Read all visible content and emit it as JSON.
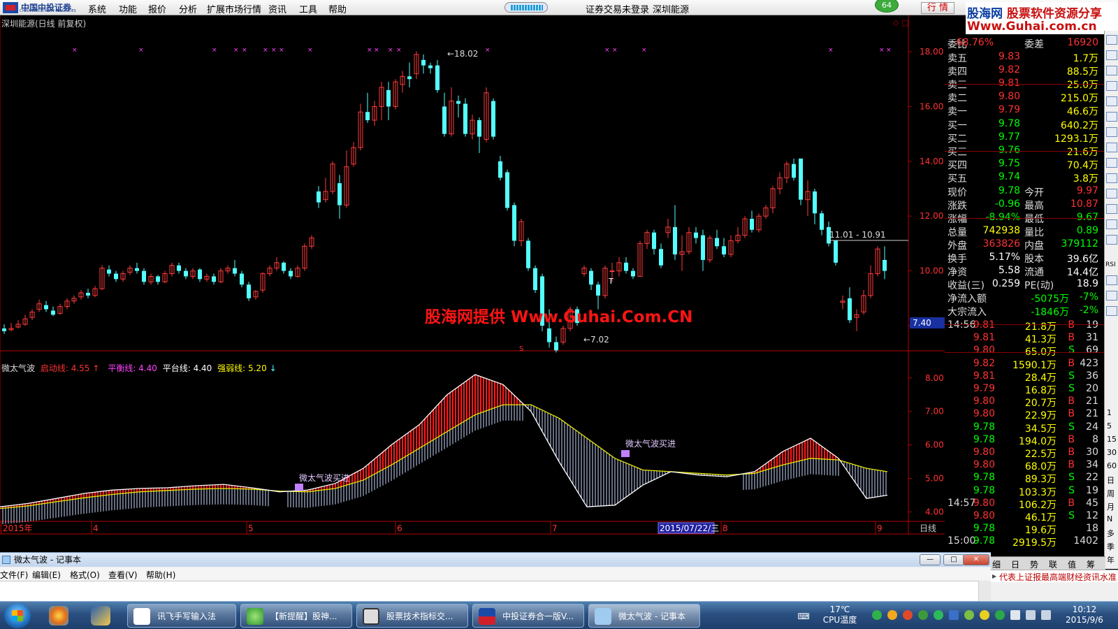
{
  "menubar": {
    "logo_text": "中国中投证券",
    "logo_sub": "CHINA INVESTMENT SECURITIES",
    "items": [
      "系统",
      "功能",
      "报价",
      "分析",
      "扩展市场行情",
      "资讯",
      "工具",
      "帮助"
    ],
    "trade_status": "证券交易未登录",
    "stock_name": "深圳能源",
    "badge": "64",
    "quote_button": "行 情"
  },
  "watermark": {
    "line1_a": "股海网",
    "line1_b": "股票软件资源分享",
    "line2": "Www.Guhai.com.cn",
    "center": "股海网提供 Www.Guhai.Com.CN"
  },
  "chart": {
    "title": "深圳能源(日线 前复权)",
    "high_label": "18.02",
    "low_label": "7.02",
    "range_label": "11.01 - 10.91",
    "price_box": "7.40",
    "y_ticks": [
      "18.00",
      "16.00",
      "14.00",
      "12.00",
      "10.00",
      "8.00"
    ],
    "ind_ticks": [
      "8.00",
      "7.00",
      "6.00",
      "5.00",
      "4.00"
    ],
    "x_labels": [
      "2015年",
      "4",
      "5",
      "6",
      "7",
      "2015/07/22/三",
      "8",
      "9"
    ],
    "period": "日线",
    "signal1": "微太气波买进",
    "signal2": "微太气波买进",
    "marker_T": "T",
    "marker_S": "S",
    "colors": {
      "up": "#ff3c3c",
      "down": "#54ffff",
      "diff": "#ffffff",
      "dea": "#e8e800",
      "axis": "#b00000",
      "tick": "#ff3232"
    }
  },
  "indicator": {
    "name": "微太气波",
    "start_label": "启动线: 4.55",
    "start_arrow": "↑",
    "balance_label": "平衡线: 4.40",
    "platform_label": "平台线: 4.40",
    "strength_label": "强弱线: 5.20",
    "strength_arrow": "↓"
  },
  "quote": {
    "weibi_label": "委比",
    "weibi": "68.76%",
    "weicha_label": "委差",
    "weicha": "16920",
    "asks": [
      {
        "label": "卖五",
        "price": "9.83",
        "vol": "1.7万"
      },
      {
        "label": "卖四",
        "price": "9.82",
        "vol": "88.5万"
      },
      {
        "label": "卖三",
        "price": "9.81",
        "vol": "25.0万"
      },
      {
        "label": "卖二",
        "price": "9.80",
        "vol": "215.0万"
      },
      {
        "label": "卖一",
        "price": "9.79",
        "vol": "46.6万"
      }
    ],
    "bids": [
      {
        "label": "买一",
        "price": "9.78",
        "vol": "640.2万"
      },
      {
        "label": "买二",
        "price": "9.77",
        "vol": "1293.1万"
      },
      {
        "label": "买三",
        "price": "9.76",
        "vol": "21.6万"
      },
      {
        "label": "买四",
        "price": "9.75",
        "vol": "70.4万"
      },
      {
        "label": "买五",
        "price": "9.74",
        "vol": "3.8万"
      }
    ],
    "stats": [
      {
        "l1": "现价",
        "v1": "9.78",
        "c1": "#00ff00",
        "l2": "今开",
        "v2": "9.97",
        "c2": "#ff3232"
      },
      {
        "l1": "涨跌",
        "v1": "-0.96",
        "c1": "#00ff00",
        "l2": "最高",
        "v2": "10.87",
        "c2": "#ff3232"
      },
      {
        "l1": "涨幅",
        "v1": "-8.94%",
        "c1": "#00ff00",
        "l2": "最低",
        "v2": "9.67",
        "c2": "#00ff00"
      },
      {
        "l1": "总量",
        "v1": "742938",
        "c1": "#ffff00",
        "l2": "量比",
        "v2": "0.89",
        "c2": "#00ff00"
      },
      {
        "l1": "外盘",
        "v1": "363826",
        "c1": "#ff3232",
        "l2": "内盘",
        "v2": "379112",
        "c2": "#00ff00"
      },
      {
        "l1": "换手",
        "v1": "5.17%",
        "c1": "#ffffff",
        "l2": "股本",
        "v2": "39.6亿",
        "c2": "#ffffff"
      },
      {
        "l1": "净资",
        "v1": "5.58",
        "c1": "#ffffff",
        "l2": "流通",
        "v2": "14.4亿",
        "c2": "#ffffff"
      },
      {
        "l1": "收益(三)",
        "v1": "0.259",
        "c1": "#ffffff",
        "l2": "PE(动)",
        "v2": "18.9",
        "c2": "#ffffff"
      }
    ],
    "flow": [
      {
        "label": "净流入额",
        "v1": "-5075万",
        "v2": "-7%"
      },
      {
        "label": "大宗流入",
        "v1": "-1846万",
        "v2": "-2%"
      }
    ],
    "ticks": [
      {
        "time": "14:56",
        "price": "9.81",
        "vol": "21.8万",
        "bs": "B",
        "n": "19",
        "pc": "#ff3232",
        "bc": "#ff3232"
      },
      {
        "time": "",
        "price": "9.81",
        "vol": "41.3万",
        "bs": "B",
        "n": "31",
        "pc": "#ff3232",
        "bc": "#ff3232"
      },
      {
        "time": "",
        "price": "9.80",
        "vol": "65.0万",
        "bs": "S",
        "n": "69",
        "pc": "#ff3232",
        "bc": "#00ff00"
      },
      {
        "time": "",
        "price": "9.82",
        "vol": "1590.1万",
        "bs": "B",
        "n": "423",
        "pc": "#ff3232",
        "bc": "#ff3232"
      },
      {
        "time": "",
        "price": "9.81",
        "vol": "28.4万",
        "bs": "S",
        "n": "36",
        "pc": "#ff3232",
        "bc": "#00ff00"
      },
      {
        "time": "",
        "price": "9.79",
        "vol": "16.8万",
        "bs": "S",
        "n": "20",
        "pc": "#ff3232",
        "bc": "#00ff00"
      },
      {
        "time": "",
        "price": "9.80",
        "vol": "20.7万",
        "bs": "B",
        "n": "21",
        "pc": "#ff3232",
        "bc": "#ff3232"
      },
      {
        "time": "",
        "price": "9.80",
        "vol": "22.9万",
        "bs": "B",
        "n": "21",
        "pc": "#ff3232",
        "bc": "#ff3232"
      },
      {
        "time": "",
        "price": "9.78",
        "vol": "34.5万",
        "bs": "S",
        "n": "24",
        "pc": "#00ff00",
        "bc": "#00ff00"
      },
      {
        "time": "",
        "price": "9.78",
        "vol": "194.0万",
        "bs": "B",
        "n": "8",
        "pc": "#00ff00",
        "bc": "#ff3232"
      },
      {
        "time": "",
        "price": "9.80",
        "vol": "22.5万",
        "bs": "B",
        "n": "30",
        "pc": "#ff3232",
        "bc": "#ff3232"
      },
      {
        "time": "",
        "price": "9.80",
        "vol": "68.0万",
        "bs": "B",
        "n": "34",
        "pc": "#ff3232",
        "bc": "#ff3232"
      },
      {
        "time": "",
        "price": "9.78",
        "vol": "89.3万",
        "bs": "S",
        "n": "22",
        "pc": "#00ff00",
        "bc": "#00ff00"
      },
      {
        "time": "",
        "price": "9.78",
        "vol": "103.3万",
        "bs": "S",
        "n": "19",
        "pc": "#00ff00",
        "bc": "#00ff00"
      },
      {
        "time": "14:57",
        "price": "9.80",
        "vol": "106.2万",
        "bs": "B",
        "n": "45",
        "pc": "#ff3232",
        "bc": "#ff3232"
      },
      {
        "time": "",
        "price": "9.80",
        "vol": "46.1万",
        "bs": "S",
        "n": "12",
        "pc": "#ff3232",
        "bc": "#00ff00"
      },
      {
        "time": "",
        "price": "9.78",
        "vol": "19.6万",
        "bs": "",
        "n": "18",
        "pc": "#00ff00",
        "bc": "#00ff00"
      },
      {
        "time": "15:00",
        "price": "9.78",
        "vol": "2919.5万",
        "bs": "",
        "n": "1402",
        "pc": "#00ff00",
        "bc": "#00ff00"
      }
    ],
    "tabs": [
      "细",
      "日",
      "势",
      "联",
      "值",
      "筹"
    ],
    "right_labels": [
      "1",
      "5",
      "15",
      "30",
      "60",
      "日",
      "周",
      "月",
      "N",
      "多",
      "季",
      "年"
    ],
    "rsi_label": "RSI"
  },
  "notepad": {
    "title": "微太气波 - 记事本",
    "menu": [
      "文件(F)",
      "编辑(E)",
      "格式(O)",
      "查看(V)",
      "帮助(H)"
    ]
  },
  "news": {
    "text": "代表上证报最高端财经资讯水准"
  },
  "taskbar": {
    "tasks": [
      "讯飞手写输入法",
      "【新提醒】股神...",
      "股票技术指标交...",
      "中投证券合一版V...",
      "微太气波 - 记事本"
    ],
    "temp": "17℃",
    "cpu": "CPU温度",
    "time": "10:12",
    "date": "2015/9/6"
  },
  "chart_data": {
    "type": "candlestick",
    "ylim": [
      7.0,
      18.4
    ],
    "candles": [
      [
        7.9,
        7.8,
        8.05,
        7.7
      ],
      [
        7.85,
        7.9,
        8.1,
        7.8
      ],
      [
        7.95,
        8.05,
        8.2,
        7.9
      ],
      [
        8.05,
        8.25,
        8.4,
        8.0
      ],
      [
        8.3,
        8.5,
        8.6,
        8.2
      ],
      [
        8.6,
        8.8,
        8.95,
        8.5
      ],
      [
        8.75,
        8.6,
        8.9,
        8.5
      ],
      [
        8.55,
        8.4,
        8.7,
        8.35
      ],
      [
        8.45,
        8.7,
        8.8,
        8.4
      ],
      [
        8.7,
        8.9,
        9.0,
        8.6
      ],
      [
        8.9,
        9.0,
        9.1,
        8.8
      ],
      [
        9.05,
        9.2,
        9.3,
        8.95
      ],
      [
        9.2,
        9.1,
        9.35,
        9.0
      ],
      [
        9.1,
        9.35,
        9.45,
        9.05
      ],
      [
        9.35,
        10.1,
        10.2,
        9.3
      ],
      [
        10.05,
        9.9,
        10.2,
        9.8
      ],
      [
        9.9,
        9.7,
        10.0,
        9.6
      ],
      [
        9.7,
        9.9,
        10.0,
        9.6
      ],
      [
        9.95,
        10.1,
        10.2,
        9.85
      ],
      [
        10.1,
        10.0,
        10.3,
        9.9
      ],
      [
        10.0,
        9.6,
        10.1,
        9.5
      ],
      [
        9.6,
        9.8,
        9.9,
        9.5
      ],
      [
        9.8,
        9.6,
        9.85,
        9.5
      ],
      [
        9.6,
        9.9,
        10.0,
        9.55
      ],
      [
        9.9,
        10.2,
        10.3,
        9.8
      ],
      [
        10.2,
        10.0,
        10.3,
        9.9
      ],
      [
        10.0,
        9.8,
        10.1,
        9.7
      ],
      [
        9.8,
        10.0,
        10.1,
        9.7
      ],
      [
        10.05,
        9.7,
        10.1,
        9.6
      ],
      [
        9.7,
        9.8,
        9.9,
        9.6
      ],
      [
        9.8,
        9.6,
        9.9,
        9.5
      ],
      [
        9.6,
        10.0,
        10.1,
        9.55
      ],
      [
        10.0,
        10.1,
        10.2,
        9.9
      ],
      [
        10.1,
        9.9,
        10.4,
        9.8
      ],
      [
        9.9,
        9.5,
        10.0,
        9.4
      ],
      [
        9.5,
        9.0,
        9.6,
        8.9
      ],
      [
        9.05,
        9.25,
        9.3,
        8.95
      ],
      [
        9.3,
        9.9,
        9.95,
        9.2
      ],
      [
        9.9,
        10.1,
        10.2,
        9.8
      ],
      [
        10.1,
        10.3,
        10.5,
        10.0
      ],
      [
        10.3,
        10.0,
        10.35,
        9.9
      ],
      [
        10.0,
        9.8,
        10.1,
        9.7
      ],
      [
        9.8,
        10.1,
        10.2,
        9.75
      ],
      [
        10.1,
        10.9,
        11.0,
        10.0
      ],
      [
        10.9,
        11.2,
        11.3,
        10.8
      ],
      [
        12.9,
        12.5,
        13.1,
        12.3
      ],
      [
        12.6,
        12.9,
        13.4,
        12.5
      ],
      [
        12.9,
        13.9,
        14.0,
        12.8
      ],
      [
        13.2,
        12.4,
        13.5,
        11.9
      ],
      [
        12.4,
        13.8,
        14.4,
        12.3
      ],
      [
        13.9,
        14.5,
        14.7,
        13.8
      ],
      [
        14.5,
        15.8,
        16.1,
        14.4
      ],
      [
        15.8,
        15.5,
        16.5,
        15.4
      ],
      [
        15.5,
        16.0,
        16.2,
        15.3
      ],
      [
        16.0,
        16.7,
        16.9,
        15.5
      ],
      [
        16.6,
        16.0,
        16.9,
        15.5
      ],
      [
        16.0,
        16.9,
        17.0,
        15.9
      ],
      [
        16.8,
        17.1,
        17.3,
        16.5
      ],
      [
        17.1,
        17.0,
        17.6,
        16.7
      ],
      [
        17.2,
        17.9,
        18.02,
        17.0
      ],
      [
        17.7,
        17.5,
        17.9,
        17.2
      ],
      [
        17.5,
        17.4,
        17.6,
        17.2
      ],
      [
        17.5,
        16.6,
        17.7,
        16.5
      ],
      [
        16.0,
        15.0,
        16.5,
        14.9
      ],
      [
        15.0,
        16.2,
        16.7,
        14.9
      ],
      [
        16.2,
        16.1,
        16.4,
        15.6
      ],
      [
        16.1,
        15.0,
        16.3,
        14.9
      ],
      [
        15.0,
        15.5,
        15.7,
        14.8
      ],
      [
        15.5,
        14.9,
        15.6,
        14.3
      ],
      [
        14.8,
        16.5,
        16.7,
        14.7
      ],
      [
        16.2,
        14.9,
        16.3,
        14.8
      ],
      [
        14.0,
        13.4,
        14.2,
        13.3
      ],
      [
        13.6,
        12.3,
        13.7,
        12.2
      ],
      [
        12.4,
        11.1,
        12.5,
        10.9
      ],
      [
        11.1,
        11.8,
        11.9,
        10.9
      ],
      [
        11.1,
        10.1,
        11.2,
        10.0
      ],
      [
        10.1,
        9.3,
        10.2,
        9.2
      ],
      [
        9.8,
        8.0,
        9.9,
        7.8
      ],
      [
        7.9,
        7.4,
        8.6,
        7.2
      ],
      [
        7.4,
        7.1,
        7.6,
        7.02
      ],
      [
        7.4,
        7.9,
        8.0,
        7.3
      ],
      [
        7.9,
        8.6,
        8.7,
        7.8
      ],
      [
        8.6,
        8.1,
        8.7,
        8.0
      ],
      [
        9.9,
        10.1,
        10.2,
        9.8
      ],
      [
        10.0,
        9.5,
        10.1,
        9.3
      ],
      [
        9.5,
        9.1,
        9.6,
        8.6
      ],
      [
        9.1,
        10.1,
        10.2,
        9.0
      ],
      [
        10.0,
        10.0,
        10.3,
        9.6
      ],
      [
        10.0,
        10.3,
        10.5,
        9.8
      ],
      [
        10.3,
        10.0,
        10.5,
        9.9
      ],
      [
        10.0,
        9.8,
        10.1,
        9.7
      ],
      [
        9.8,
        11.0,
        11.1,
        9.8
      ],
      [
        11.0,
        11.4,
        11.5,
        10.8
      ],
      [
        11.4,
        10.8,
        11.5,
        10.6
      ],
      [
        10.8,
        10.2,
        11.0,
        10.1
      ],
      [
        11.4,
        11.6,
        11.9,
        11.2
      ],
      [
        11.6,
        10.6,
        12.4,
        10.4
      ],
      [
        10.6,
        10.7,
        11.3,
        10.0
      ],
      [
        10.7,
        11.4,
        11.6,
        10.6
      ],
      [
        11.4,
        11.2,
        11.6,
        11.0
      ],
      [
        11.3,
        10.4,
        11.5,
        10.0
      ],
      [
        10.4,
        11.2,
        11.3,
        10.3
      ],
      [
        11.2,
        10.9,
        11.5,
        10.8
      ],
      [
        10.9,
        10.6,
        11.2,
        10.5
      ],
      [
        10.6,
        11.1,
        11.3,
        10.5
      ],
      [
        11.1,
        11.3,
        11.6,
        11.0
      ],
      [
        11.3,
        11.9,
        12.0,
        11.2
      ],
      [
        11.9,
        11.5,
        12.2,
        11.4
      ],
      [
        11.5,
        12.0,
        12.1,
        11.4
      ],
      [
        12.0,
        12.3,
        12.4,
        11.9
      ],
      [
        12.3,
        13.0,
        13.1,
        12.1
      ],
      [
        13.0,
        13.4,
        13.6,
        12.8
      ],
      [
        13.4,
        13.9,
        14.0,
        13.2
      ],
      [
        13.9,
        13.4,
        14.1,
        13.3
      ],
      [
        14.1,
        12.6,
        14.1,
        12.4
      ],
      [
        12.6,
        12.9,
        13.3,
        12.0
      ],
      [
        12.9,
        12.1,
        13.0,
        11.7
      ],
      [
        12.1,
        11.5,
        12.2,
        11.3
      ],
      [
        11.6,
        11.0,
        11.8,
        10.9
      ],
      [
        11.1,
        10.3,
        11.1,
        10.2
      ],
      [
        8.85,
        8.9,
        9.1,
        8.6
      ],
      [
        9.0,
        8.2,
        9.4,
        8.1
      ],
      [
        8.3,
        8.4,
        8.6,
        7.8
      ],
      [
        8.5,
        9.1,
        9.3,
        8.4
      ],
      [
        9.1,
        9.9,
        10.2,
        9.0
      ],
      [
        9.9,
        10.8,
        10.9,
        9.8
      ],
      [
        10.4,
        10.0,
        10.9,
        9.7
      ]
    ],
    "diff": [
      [
        0,
        4.15
      ],
      [
        40,
        4.25
      ],
      [
        80,
        4.4
      ],
      [
        120,
        4.55
      ],
      [
        160,
        4.65
      ],
      [
        200,
        4.7
      ],
      [
        240,
        4.72
      ],
      [
        280,
        4.78
      ],
      [
        320,
        4.82
      ],
      [
        360,
        4.72
      ],
      [
        400,
        4.6
      ],
      [
        440,
        4.65
      ],
      [
        480,
        4.85
      ],
      [
        520,
        5.3
      ],
      [
        560,
        6.0
      ],
      [
        600,
        6.6
      ],
      [
        640,
        7.5
      ],
      [
        680,
        8.1
      ],
      [
        720,
        7.8
      ],
      [
        760,
        7.0
      ],
      [
        800,
        5.5
      ],
      [
        840,
        4.15
      ],
      [
        880,
        4.2
      ],
      [
        920,
        4.8
      ],
      [
        960,
        5.2
      ],
      [
        1000,
        5.1
      ],
      [
        1040,
        5.05
      ],
      [
        1080,
        5.2
      ],
      [
        1120,
        5.8
      ],
      [
        1160,
        6.2
      ],
      [
        1200,
        5.6
      ],
      [
        1240,
        4.4
      ],
      [
        1270,
        4.5
      ]
    ],
    "dea": [
      [
        0,
        4.1
      ],
      [
        40,
        4.18
      ],
      [
        80,
        4.3
      ],
      [
        120,
        4.42
      ],
      [
        160,
        4.52
      ],
      [
        200,
        4.6
      ],
      [
        240,
        4.64
      ],
      [
        280,
        4.68
      ],
      [
        320,
        4.7
      ],
      [
        360,
        4.68
      ],
      [
        400,
        4.62
      ],
      [
        440,
        4.6
      ],
      [
        480,
        4.7
      ],
      [
        520,
        4.95
      ],
      [
        560,
        5.4
      ],
      [
        600,
        5.9
      ],
      [
        640,
        6.4
      ],
      [
        680,
        6.9
      ],
      [
        720,
        7.2
      ],
      [
        760,
        7.2
      ],
      [
        800,
        6.8
      ],
      [
        840,
        6.2
      ],
      [
        880,
        5.6
      ],
      [
        920,
        5.25
      ],
      [
        960,
        5.2
      ],
      [
        1000,
        5.15
      ],
      [
        1040,
        5.1
      ],
      [
        1080,
        5.15
      ],
      [
        1120,
        5.4
      ],
      [
        1160,
        5.6
      ],
      [
        1200,
        5.55
      ],
      [
        1240,
        5.3
      ],
      [
        1270,
        5.2
      ]
    ],
    "ind_ylim": [
      3.8,
      8.6
    ]
  }
}
